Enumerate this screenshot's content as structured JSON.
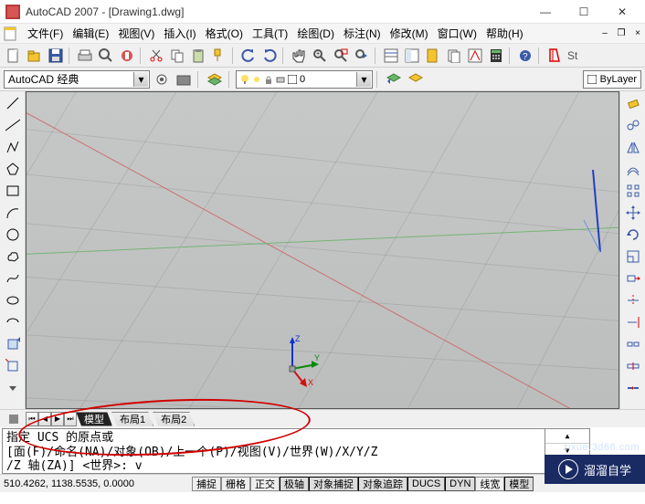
{
  "title": "AutoCAD 2007 - [Drawing1.dwg]",
  "window_controls": {
    "min": "—",
    "max": "☐",
    "close": "✕"
  },
  "doc_controls": {
    "min": "–",
    "restore": "❐",
    "close": "×"
  },
  "menu": {
    "file": "文件(F)",
    "edit": "编辑(E)",
    "view": "视图(V)",
    "insert": "插入(I)",
    "format": "格式(O)",
    "tools": "工具(T)",
    "draw": "绘图(D)",
    "dimension": "标注(N)",
    "modify": "修改(M)",
    "window": "窗口(W)",
    "help": "帮助(H)"
  },
  "toolbar2": {
    "standards_label": "St"
  },
  "workspace": {
    "selected": "AutoCAD 经典"
  },
  "layer": {
    "current": "0",
    "bylayer": "ByLayer"
  },
  "tabs": {
    "model": "模型",
    "layout1": "布局1",
    "layout2": "布局2"
  },
  "commandline": {
    "line1": "指定 UCS 的原点或",
    "line2": "[面(F)/命名(NA)/对象(OB)/上一个(P)/视图(V)/世界(W)/X/Y/Z",
    "line3": "/Z 轴(ZA)] <世界>: v"
  },
  "status": {
    "coords": "510.4262,   1138.5535,  0.0000",
    "toggles": {
      "snap": "捕捉",
      "grid": "栅格",
      "ortho": "正交",
      "polar": "极轴",
      "osnap": "对象捕捉",
      "otrack": "对象追踪",
      "ducs": "DUCS",
      "dyn": "DYN",
      "lwt": "线宽",
      "model": "模型"
    }
  },
  "ucs_labels": {
    "x": "X",
    "y": "Y",
    "z": "Z"
  },
  "watermark": {
    "text": "溜溜自学",
    "site": "zixue.3d66.com"
  }
}
